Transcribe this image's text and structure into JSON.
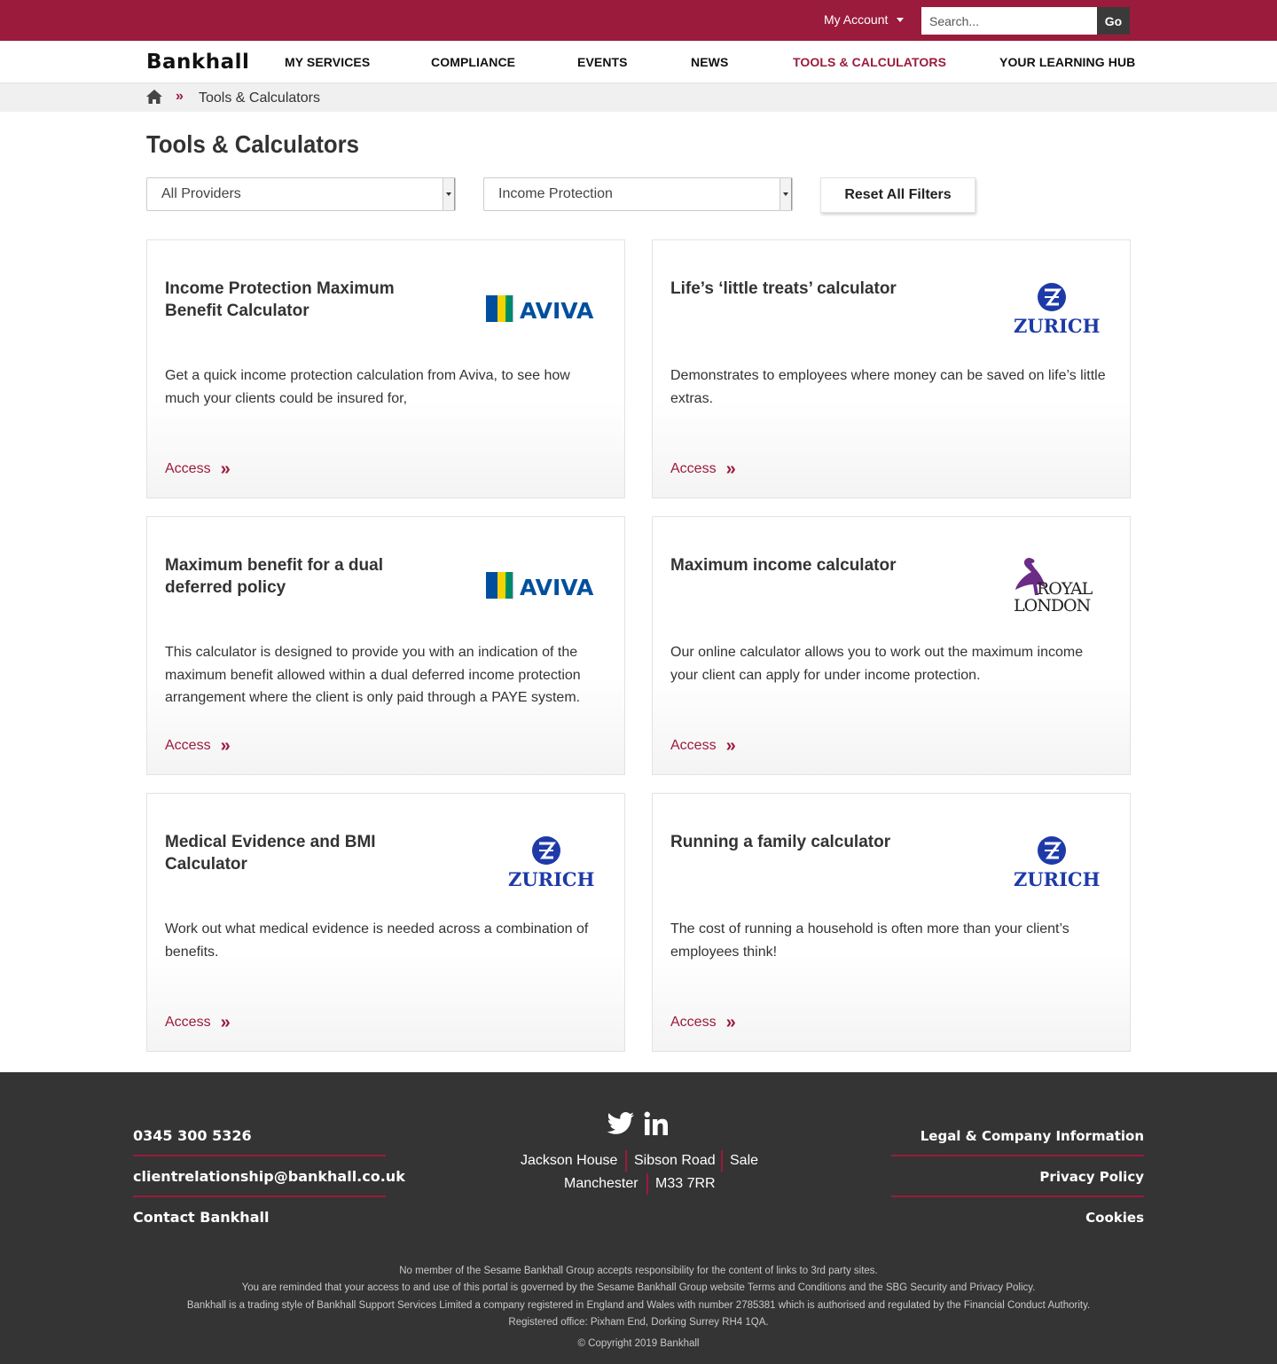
{
  "header": {
    "account_label": "My Account",
    "search_placeholder": "Search...",
    "go_label": "Go"
  },
  "nav": {
    "logo": "Bankhall",
    "items": [
      {
        "label": "MY SERVICES"
      },
      {
        "label": "COMPLIANCE"
      },
      {
        "label": "EVENTS"
      },
      {
        "label": "NEWS"
      },
      {
        "label": "TOOLS & CALCULATORS",
        "active": true
      },
      {
        "label": "YOUR LEARNING HUB"
      }
    ]
  },
  "breadcrumb": {
    "separator": "»",
    "current": "Tools & Calculators"
  },
  "page": {
    "title": "Tools & Calculators"
  },
  "filters": {
    "provider": "All Providers",
    "category": "Income Protection",
    "reset_label": "Reset All Filters"
  },
  "cards": [
    {
      "title": "Income Protection Maximum Benefit Calculator",
      "provider": "AVIVA",
      "description": "Get a quick income protection calculation from Aviva, to see how much your clients could be insured for,",
      "link": "Access"
    },
    {
      "title": "Life’s ‘little treats’ calculator",
      "provider": "ZURICH",
      "description": "Demonstrates to employees where money can be saved on life’s little extras.",
      "link": "Access"
    },
    {
      "title": "Maximum benefit for a dual deferred policy",
      "provider": "AVIVA",
      "description": "This calculator is designed to provide you with an indication of the maximum benefit allowed within a dual deferred income protection arrangement where the client is only paid through a PAYE system.",
      "link": "Access"
    },
    {
      "title": "Maximum income calculator",
      "provider_line1": "ROYAL",
      "provider_line2": "LONDON",
      "description": "Our online calculator allows you to work out the maximum income your client can apply for under income protection.",
      "link": "Access"
    },
    {
      "title": "Medical Evidence and BMI Calculator",
      "provider": "ZURICH",
      "description": "Work out what medical evidence is needed across a combination of benefits.",
      "link": "Access"
    },
    {
      "title": "Running a family calculator",
      "provider": "ZURICH",
      "description": "The cost of running a household is often more than your client’s employees think!",
      "link": "Access"
    }
  ],
  "footer": {
    "phone": "0345 300 5326",
    "email": "clientrelationship@bankhall.co.uk",
    "contact": "Contact Bankhall",
    "address": [
      "Jackson House",
      "Sibson Road",
      "Sale",
      "Manchester",
      "M33 7RR"
    ],
    "links": [
      "Legal & Company Information",
      "Privacy Policy",
      "Cookies"
    ],
    "disclaimer": [
      "No member of the Sesame Bankhall Group accepts responsibility for the content of links to 3rd party sites.",
      "You are reminded that your access to and use of this portal is governed by the Sesame Bankhall Group website Terms and Conditions and the SBG Security and Privacy Policy.",
      "Bankhall is a trading style of Bankhall Support Services Limited a company registered in England and Wales with number 2785381 which is authorised and regulated by the Financial Conduct Authority.",
      "Registered office: Pixham End, Dorking Surrey RH4 1QA."
    ],
    "copyright": "© Copyright 2019 Bankhall"
  },
  "colors": {
    "brand": "#9b1b3c",
    "footer_bg": "#343434",
    "aviva_blue": "#004f9f",
    "zurich_blue": "#1e3aa8",
    "royal_london_purple": "#6b2c86"
  },
  "icons": [
    "home-icon",
    "twitter-icon",
    "linkedin-icon",
    "chevron-double-right-icon",
    "caret-down-icon"
  ]
}
